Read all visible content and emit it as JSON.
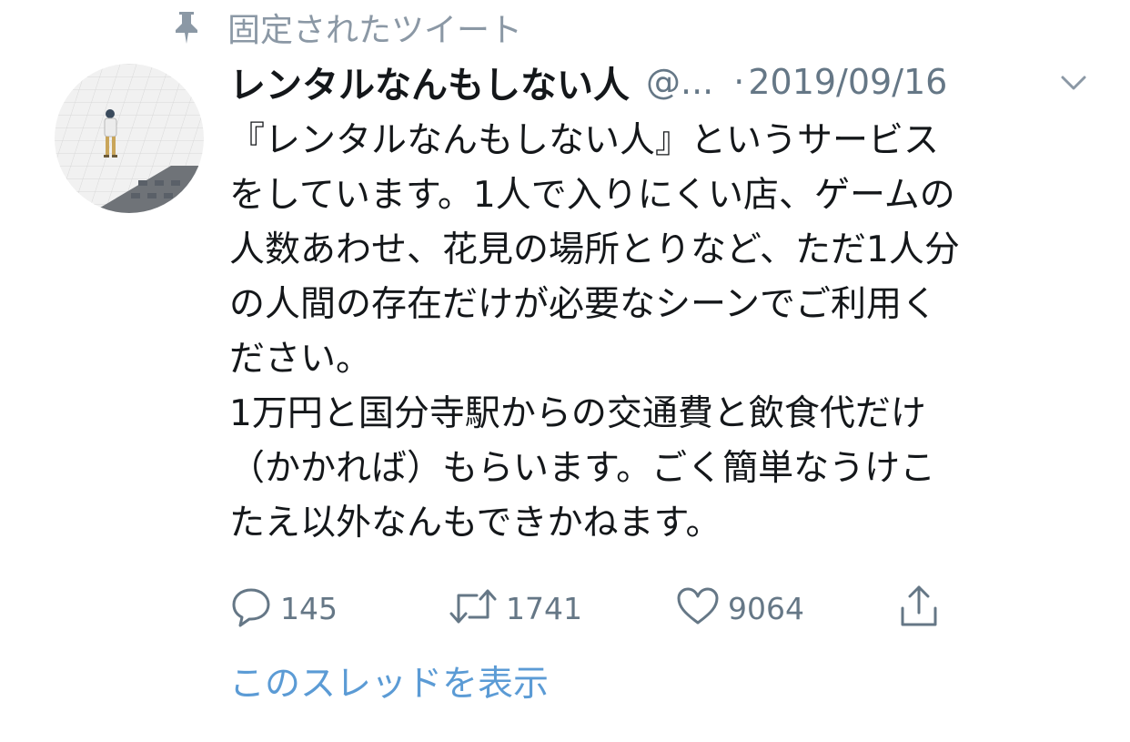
{
  "pinned": {
    "label": "固定されたツイート",
    "icon": "pin-icon"
  },
  "tweet": {
    "display_name": "レンタルなんもしない人",
    "handle": "@...",
    "separator": "·",
    "date": "2019/09/16",
    "text_lines": [
      "『レンタルなんもしない人』というサービス",
      "をしています。1人で入りにくい店、ゲームの",
      "人数あわせ、花見の場所とりなど、ただ1人分",
      "の人間の存在だけが必要なシーンでご利用く",
      "ださい。",
      "1万円と国分寺駅からの交通費と飲食代だけ",
      "（かかれば）もらいます。ごく簡単なうけこ",
      "たえ以外なんもできかねます。"
    ],
    "actions": {
      "reply_count": "145",
      "retweet_count": "1741",
      "like_count": "9064"
    },
    "show_thread": "このスレッドを表示"
  },
  "colors": {
    "text": "#14171a",
    "muted": "#657786",
    "pinned": "#8b98a5",
    "link": "#5b9bd5",
    "icon": "#657786"
  }
}
